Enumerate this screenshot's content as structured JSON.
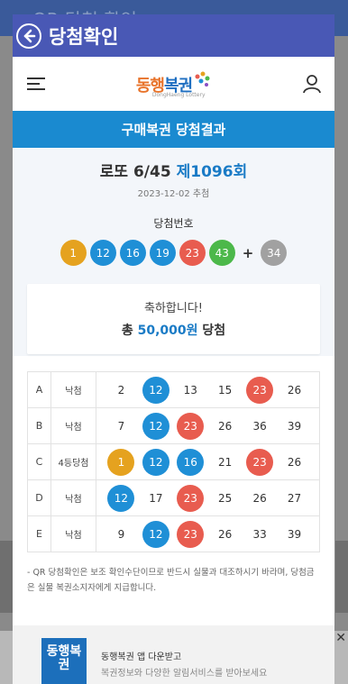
{
  "background": {
    "title": "QR 당첨 확인"
  },
  "modal": {
    "title": "당첨확인",
    "back_icon": "arrow-left-circle-icon"
  },
  "header": {
    "logo_text_1": "동행",
    "logo_text_2": "복권",
    "logo_sub": "DongHaeng Lottery",
    "menu_icon": "hamburger-icon",
    "user_icon": "user-icon"
  },
  "banner": {
    "title": "구매복권 당첨결과"
  },
  "draw": {
    "game": "로또 6/45",
    "round": "제1096회",
    "date": "2023-12-02 추첨",
    "win_label": "당첨번호",
    "numbers": [
      {
        "n": "1",
        "color": "#e5a21f"
      },
      {
        "n": "12",
        "color": "#1f8fd6"
      },
      {
        "n": "16",
        "color": "#1f8fd6"
      },
      {
        "n": "19",
        "color": "#1f8fd6"
      },
      {
        "n": "23",
        "color": "#e85c4f"
      },
      {
        "n": "43",
        "color": "#4cb84a"
      }
    ],
    "plus": "+",
    "bonus": {
      "n": "34",
      "color": "#a1a1a1"
    }
  },
  "result": {
    "congrats": "축하합니다!",
    "prefix": "총",
    "amount": "50,000원",
    "suffix": "당첨"
  },
  "tickets": [
    {
      "id": "A",
      "status": "낙첨",
      "nums": [
        {
          "n": "2",
          "c": ""
        },
        {
          "n": "12",
          "c": "#1f8fd6"
        },
        {
          "n": "13",
          "c": ""
        },
        {
          "n": "15",
          "c": ""
        },
        {
          "n": "23",
          "c": "#e85c4f"
        },
        {
          "n": "26",
          "c": ""
        }
      ]
    },
    {
      "id": "B",
      "status": "낙첨",
      "nums": [
        {
          "n": "7",
          "c": ""
        },
        {
          "n": "12",
          "c": "#1f8fd6"
        },
        {
          "n": "23",
          "c": "#e85c4f"
        },
        {
          "n": "26",
          "c": ""
        },
        {
          "n": "36",
          "c": ""
        },
        {
          "n": "39",
          "c": ""
        }
      ]
    },
    {
      "id": "C",
      "status": "4등당첨",
      "nums": [
        {
          "n": "1",
          "c": "#e5a21f"
        },
        {
          "n": "12",
          "c": "#1f8fd6"
        },
        {
          "n": "16",
          "c": "#1f8fd6"
        },
        {
          "n": "21",
          "c": ""
        },
        {
          "n": "23",
          "c": "#e85c4f"
        },
        {
          "n": "26",
          "c": ""
        }
      ]
    },
    {
      "id": "D",
      "status": "낙첨",
      "nums": [
        {
          "n": "12",
          "c": "#1f8fd6"
        },
        {
          "n": "17",
          "c": ""
        },
        {
          "n": "23",
          "c": "#e85c4f"
        },
        {
          "n": "25",
          "c": ""
        },
        {
          "n": "26",
          "c": ""
        },
        {
          "n": "27",
          "c": ""
        }
      ]
    },
    {
      "id": "E",
      "status": "낙첨",
      "nums": [
        {
          "n": "9",
          "c": ""
        },
        {
          "n": "12",
          "c": "#1f8fd6"
        },
        {
          "n": "23",
          "c": "#e85c4f"
        },
        {
          "n": "26",
          "c": ""
        },
        {
          "n": "33",
          "c": ""
        },
        {
          "n": "39",
          "c": ""
        }
      ]
    }
  ],
  "notice": "- QR 당첨확인은 보조 확인수단이므로 반드시 실물과 대조하시기 바라며, 당첨금은 실물 복권소지자에게 지급합니다.",
  "app_banner": {
    "logo": "동행복권",
    "line1": "동행복권 앱 다운받고",
    "line2": "복권정보와 다양한 알림서비스를 받아보세요"
  }
}
